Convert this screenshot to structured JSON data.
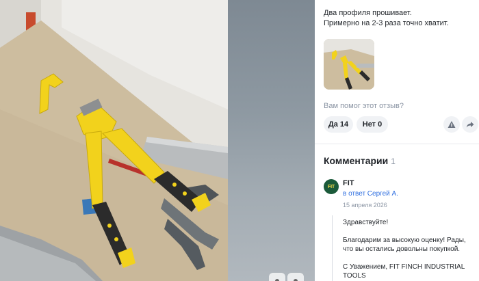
{
  "review": {
    "text_line1": "Два профиля прошивает.",
    "text_line2": "Примерно на 2-3 раза точно хватит."
  },
  "helpful": {
    "question": "Вам помог этот отзыв?",
    "yes_label": "Да 14",
    "no_label": "Нет 0"
  },
  "comments": {
    "title": "Комментарии",
    "count": "1",
    "items": [
      {
        "author": "FIT",
        "avatar_text": "FIT",
        "reply_to": "в ответ Сергей А.",
        "date": "15 апреля 2026",
        "greeting": "Здравствуйте!",
        "body": "Благодарим за высокую оценку! Рады, что вы остались довольны покупкой.",
        "signature": "С Уважением, FIT FINCH INDUSTRIAL TOOLS"
      }
    ]
  },
  "icons": {
    "report": "warning-icon",
    "share": "share-arrow-icon",
    "viewer_left": "viewer-control-icon",
    "viewer_right": "viewer-control-icon"
  },
  "colors": {
    "accent_link": "#2f6fe0",
    "muted_text": "#8a94a3",
    "tool_yellow": "#f2d21c",
    "button_bg": "#f0f2f5",
    "avatar_bg": "#1b5a3a"
  }
}
